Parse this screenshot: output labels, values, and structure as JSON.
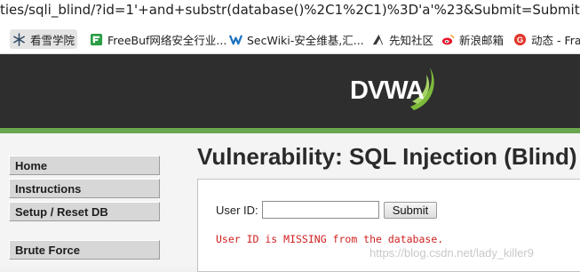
{
  "browser": {
    "url": "ties/sqli_blind/?id=1'+and+substr(database()%2C1%2C1)%3D'a'%23&Submit=Submit#",
    "bookmarks": [
      {
        "label": "看雪学院",
        "icon": "snowflake-icon",
        "active": true
      },
      {
        "label": "FreeBuf网络安全行业...",
        "icon": "freebuf-icon"
      },
      {
        "label": "SecWiki-安全维基,汇...",
        "icon": "secwiki-icon"
      },
      {
        "label": "先知社区",
        "icon": "xianzhi-icon"
      },
      {
        "label": "新浪邮箱",
        "icon": "weibo-icon"
      },
      {
        "label": "动态 - Fra",
        "icon": "dynamic-icon"
      }
    ]
  },
  "header": {
    "logo_text": "DVWA",
    "bar_color": "#2e2e2e",
    "accent": "#6aa84f"
  },
  "menu": {
    "items": [
      {
        "label": "Home"
      },
      {
        "label": "Instructions"
      },
      {
        "label": "Setup / Reset DB"
      },
      {
        "label": "Brute Force"
      }
    ]
  },
  "main": {
    "title": "Vulnerability: SQL Injection (Blind)",
    "form": {
      "user_id_label": "User ID:",
      "user_id_value": "",
      "submit_label": "Submit"
    },
    "message": "User ID is MISSING from the database.",
    "message_color": "#d02020"
  },
  "watermark": "https://blog.csdn.net/lady_killer9"
}
